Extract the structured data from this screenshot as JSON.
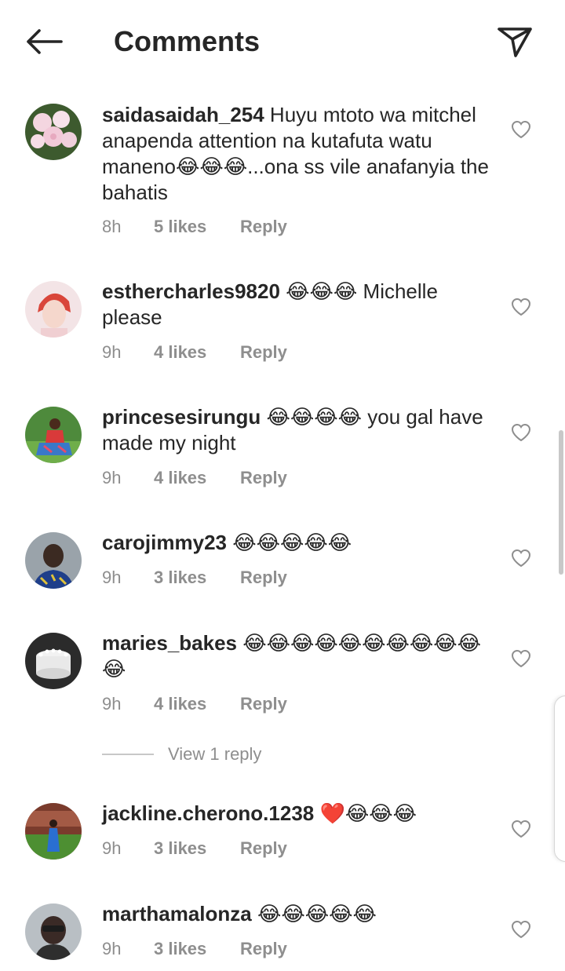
{
  "header": {
    "title": "Comments",
    "back_icon": "arrow-left-icon",
    "send_icon": "paper-plane-icon"
  },
  "comments": [
    {
      "username": "saidasaidah_254",
      "text": " Huyu mtoto wa mitchel anapenda attention na kutafuta watu maneno😂😂😂...ona ss vile anafanyia the bahatis",
      "time": "8h",
      "likes": "5 likes",
      "reply": "Reply",
      "avatar_icon": "flower-photo-avatar"
    },
    {
      "username": "esthercharles9820",
      "text": " 😂😂😂 Michelle please",
      "time": "9h",
      "likes": "4 likes",
      "reply": "Reply",
      "avatar_icon": "person-photo-avatar"
    },
    {
      "username": "princesesirungu",
      "text": " 😂😂😂😂 you gal have made my night",
      "time": "9h",
      "likes": "4 likes",
      "reply": "Reply",
      "avatar_icon": "person-photo-avatar"
    },
    {
      "username": "carojimmy23",
      "text": " 😂😂😂😂😂",
      "time": "9h",
      "likes": "3 likes",
      "reply": "Reply",
      "avatar_icon": "person-photo-avatar"
    },
    {
      "username": "maries_bakes",
      "text": " 😂😂😂😂😂😂😂😂😂😂😂",
      "time": "9h",
      "likes": "4 likes",
      "reply": "Reply",
      "avatar_icon": "cake-photo-avatar"
    },
    {
      "username": "jackline.cherono.1238",
      "text": " ❤️😂😂😂",
      "time": "9h",
      "likes": "3 likes",
      "reply": "Reply",
      "avatar_icon": "person-photo-avatar"
    },
    {
      "username": "marthamalonza",
      "text": " 😂😂😂😂😂",
      "time": "9h",
      "likes": "3 likes",
      "reply": "Reply",
      "avatar_icon": "person-photo-avatar"
    }
  ],
  "view_replies": {
    "label": "View 1 reply"
  },
  "colors": {
    "primary_text": "#262626",
    "secondary_text": "#8e8e8e",
    "background": "#ffffff"
  }
}
